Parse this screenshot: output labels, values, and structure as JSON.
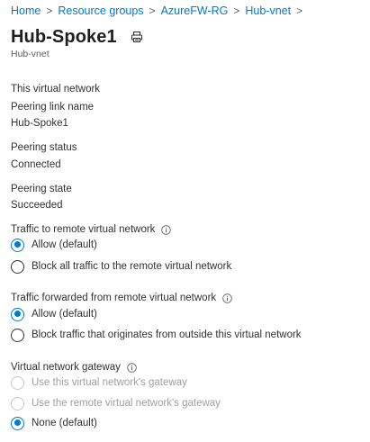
{
  "breadcrumb": {
    "items": [
      "Home",
      "Resource groups",
      "AzureFW-RG",
      "Hub-vnet"
    ],
    "separator": ">"
  },
  "header": {
    "title": "Hub-Spoke1",
    "subtitle": "Hub-vnet",
    "print_icon": "print-icon"
  },
  "details": {
    "this_vnet_heading": "This virtual network",
    "peering_link_name_label": "Peering link name",
    "peering_link_name_value": "Hub-Spoke1",
    "peering_status_label": "Peering status",
    "peering_status_value": "Connected",
    "peering_state_label": "Peering state",
    "peering_state_value": "Succeeded"
  },
  "traffic_to_remote": {
    "label": "Traffic to remote virtual network",
    "options": [
      "Allow (default)",
      "Block all traffic to the remote virtual network"
    ],
    "selected": "Allow (default)"
  },
  "traffic_forwarded": {
    "label": "Traffic forwarded from remote virtual network",
    "options": [
      "Allow (default)",
      "Block traffic that originates from outside this virtual network"
    ],
    "selected": "Allow (default)"
  },
  "gateway": {
    "label": "Virtual network gateway",
    "options": [
      "Use this virtual network's gateway",
      "Use the remote virtual network's gateway",
      "None (default)"
    ],
    "selected": "None (default)",
    "disabled_options": [
      "Use this virtual network's gateway",
      "Use the remote virtual network's gateway"
    ]
  },
  "colors": {
    "accent": "#0078d4",
    "text": "#323130",
    "muted": "#605e5c",
    "disabled": "#a19f9d"
  }
}
